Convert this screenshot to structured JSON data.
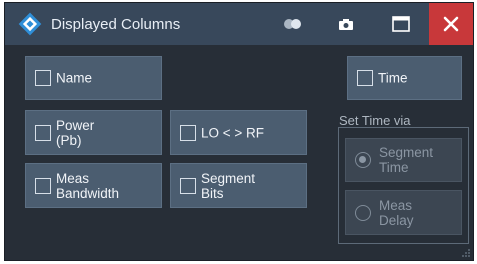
{
  "window": {
    "title": "Displayed Columns",
    "accent_close": "#c8383a"
  },
  "titlebar": {
    "icons": [
      "rs-logo-icon",
      "toggle-icon",
      "camera-icon",
      "maximize-icon",
      "close-icon"
    ]
  },
  "columns": {
    "name": "Name",
    "power": "Power\n(Pb)",
    "lo_rf": "LO < > RF",
    "meas_bandwidth": "Meas\nBandwidth",
    "segment_bits": "Segment\nBits",
    "time": "Time"
  },
  "set_time_via": {
    "label": "Set Time via",
    "segment_time": "Segment\nTime",
    "meas_delay": "Meas\nDelay",
    "selected": "segment_time"
  }
}
